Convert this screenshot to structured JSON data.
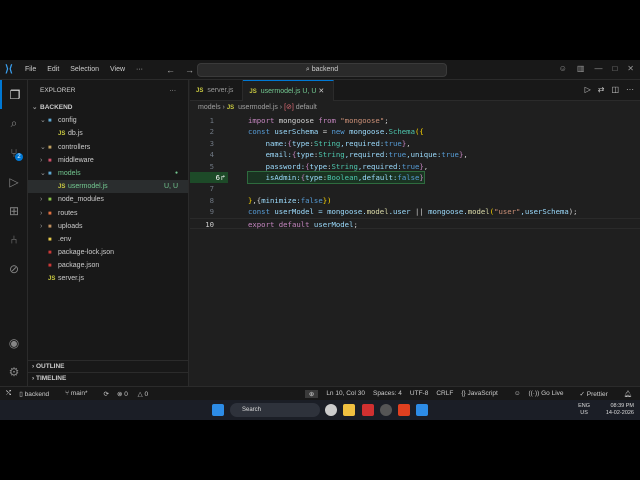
{
  "titlebar": {
    "menu": [
      "File",
      "Edit",
      "Selection",
      "View",
      "···"
    ],
    "search": "backend"
  },
  "activity": {
    "scm_badge": "2"
  },
  "sidebar": {
    "title": "EXPLORER",
    "more": "···",
    "root": "BACKEND",
    "items": [
      {
        "label": "config",
        "type": "folder",
        "open": true,
        "depth": 1,
        "color": "#5fa8d3"
      },
      {
        "label": "db.js",
        "type": "js",
        "depth": 2
      },
      {
        "label": "controllers",
        "type": "folder",
        "open": true,
        "depth": 1,
        "color": "#c0a060"
      },
      {
        "label": "middleware",
        "type": "folder",
        "open": false,
        "depth": 1,
        "color": "#d0506a"
      },
      {
        "label": "models",
        "type": "folder",
        "open": true,
        "depth": 1,
        "color": "#5fa8d3",
        "git": true
      },
      {
        "label": "usermodel.js",
        "type": "js",
        "depth": 2,
        "selected": true,
        "git": true,
        "tag": "U, U"
      },
      {
        "label": "node_modules",
        "type": "folder",
        "open": false,
        "depth": 1,
        "color": "#8bc34a"
      },
      {
        "label": "routes",
        "type": "folder",
        "open": false,
        "depth": 1,
        "color": "#e07040"
      },
      {
        "label": "uploads",
        "type": "folder",
        "open": false,
        "depth": 1,
        "color": "#c09060"
      },
      {
        "label": ".env",
        "type": "env",
        "depth": 1
      },
      {
        "label": "package-lock.json",
        "type": "npm",
        "depth": 1
      },
      {
        "label": "package.json",
        "type": "npm",
        "depth": 1
      },
      {
        "label": "server.js",
        "type": "js",
        "depth": 1
      }
    ],
    "outline": "OUTLINE",
    "timeline": "TIMELINE"
  },
  "tabs": [
    {
      "label": "server.js",
      "active": false
    },
    {
      "label": "usermodel.js",
      "status": "U, U",
      "active": true
    }
  ],
  "breadcrumb": [
    "models",
    "usermodel.js",
    "default"
  ],
  "code": [
    [
      [
        "import",
        "k"
      ],
      [
        " mongoose ",
        "p"
      ],
      [
        "from",
        "k"
      ],
      [
        " ",
        "p"
      ],
      [
        "\"mongoose\"",
        "s"
      ],
      [
        ";",
        "p"
      ]
    ],
    [
      [
        "const",
        "kb"
      ],
      [
        " userSchema ",
        "v"
      ],
      [
        "= ",
        "p"
      ],
      [
        "new",
        "kb"
      ],
      [
        " mongoose.",
        "v"
      ],
      [
        "Schema",
        "t"
      ],
      [
        "({",
        "b"
      ]
    ],
    [
      [
        "    name:",
        "v"
      ],
      [
        "{",
        "k"
      ],
      [
        "type",
        "v"
      ],
      [
        ":",
        "p"
      ],
      [
        "String",
        "t"
      ],
      [
        ",required:",
        "v"
      ],
      [
        "true",
        "n"
      ],
      [
        "}",
        "k"
      ],
      [
        ",",
        "p"
      ]
    ],
    [
      [
        "    email:",
        "v"
      ],
      [
        "{",
        "k"
      ],
      [
        "type",
        "v"
      ],
      [
        ":",
        "p"
      ],
      [
        "String",
        "t"
      ],
      [
        ",required:",
        "v"
      ],
      [
        "true",
        "n"
      ],
      [
        ",unique:",
        "v"
      ],
      [
        "true",
        "n"
      ],
      [
        "}",
        "k"
      ],
      [
        ",",
        "p"
      ]
    ],
    [
      [
        "    password:",
        "v"
      ],
      [
        "{",
        "k"
      ],
      [
        "type",
        "v"
      ],
      [
        ":",
        "p"
      ],
      [
        "String",
        "t"
      ],
      [
        ",required:",
        "v"
      ],
      [
        "true",
        "n"
      ],
      [
        "}",
        "k"
      ],
      [
        ",",
        "p"
      ]
    ],
    [
      [
        "    isAdmin:",
        "v"
      ],
      [
        "{",
        "k"
      ],
      [
        "type",
        "v"
      ],
      [
        ":",
        "p"
      ],
      [
        "Boolean",
        "t"
      ],
      [
        ",default:",
        "v"
      ],
      [
        "false",
        "n"
      ],
      [
        "}",
        "k"
      ]
    ],
    [],
    [
      [
        "}",
        "b"
      ],
      [
        ",{",
        "p"
      ],
      [
        "minimize:",
        "v"
      ],
      [
        "false",
        "n"
      ],
      [
        "})",
        "b"
      ]
    ],
    [
      [
        "const",
        "kb"
      ],
      [
        " userModel ",
        "v"
      ],
      [
        "= mongoose.",
        "v"
      ],
      [
        "model",
        "f"
      ],
      [
        ".user ",
        "v"
      ],
      [
        "|| ",
        "p"
      ],
      [
        "mongoose.",
        "v"
      ],
      [
        "model",
        "f"
      ],
      [
        "(",
        "b"
      ],
      [
        "\"user\"",
        "s"
      ],
      [
        ",userSchema",
        "v"
      ],
      [
        ");",
        "p"
      ]
    ],
    [
      [
        "export",
        "k"
      ],
      [
        " ",
        "p"
      ],
      [
        "default",
        "k"
      ],
      [
        " userModel",
        "v"
      ],
      [
        ";",
        "p"
      ]
    ]
  ],
  "line6_marker": "↱",
  "status": {
    "branch_folder": "backend",
    "git_branch": "main*",
    "errors": "0",
    "warnings": "0",
    "position": "Ln 10, Col 30",
    "spaces": "Spaces: 4",
    "encoding": "UTF-8",
    "eol": "CRLF",
    "language": "JavaScript",
    "golive": "Go Live",
    "prettier": "Prettier"
  },
  "taskbar": {
    "search": "Search",
    "lang1": "ENG",
    "lang2": "US",
    "time": "08:39 PM",
    "date": "14-02-2026"
  }
}
